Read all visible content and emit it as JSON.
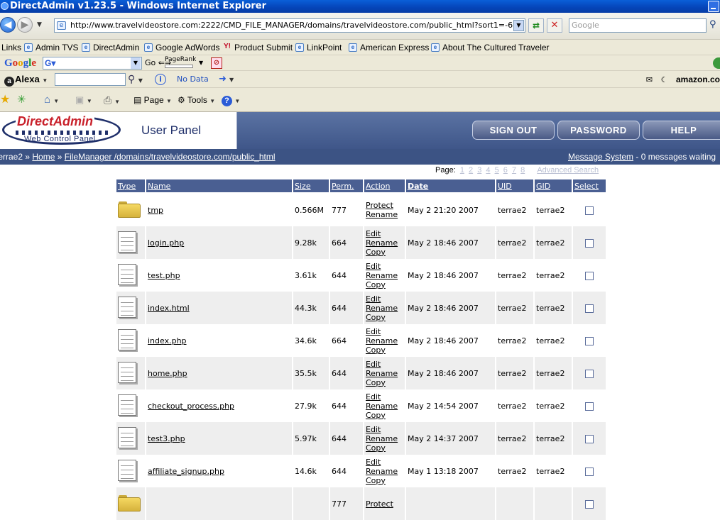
{
  "window": {
    "title": "DirectAdmin v1.23.5 - Windows Internet Explorer"
  },
  "browser": {
    "url": "http://www.travelvideostore.com:2222/CMD_FILE_MANAGER/domains/travelvideostore.com/public_html?sort1=-6",
    "search_placeholder": "Google",
    "links_label": "Links",
    "links": [
      "Admin TVS",
      "DirectAdmin",
      "Google AdWords",
      "Product Submit",
      "LinkPoint",
      "American Express",
      "About The Cultured Traveler"
    ],
    "google_toolbar": {
      "logo": "Google",
      "go_label": "Go",
      "pagerank_label": "PageRank"
    },
    "alexa_toolbar": {
      "logo": "Alexa",
      "status": "No Data",
      "amazon": "amazon.co"
    },
    "command_bar": {
      "page": "Page",
      "tools": "Tools"
    }
  },
  "da_header": {
    "logo_title": "DirectAdmin",
    "logo_subtitle": "Web Control Panel",
    "panel_title": "User Panel",
    "buttons": {
      "signout": "SIGN OUT",
      "password": "PASSWORD",
      "help": "HELP"
    }
  },
  "breadcrumb": {
    "user": "terrae2",
    "home": "Home",
    "path": "FileManager /domains/travelvideostore.com/public_html",
    "message_link": "Message System",
    "message_status": " - 0 messages waiting"
  },
  "pager": {
    "label": "Page:",
    "pages": [
      "1",
      "2",
      "3",
      "4",
      "5",
      "6",
      "7",
      "8"
    ],
    "advanced": "Advanced Search"
  },
  "files": {
    "columns": [
      "Type",
      "Name",
      "Size",
      "Perm.",
      "Action",
      "Date",
      "UID",
      "GID",
      "Select"
    ],
    "rows": [
      {
        "type": "folder",
        "name": "tmp",
        "size": "0.566M",
        "perm": "777",
        "actions": [
          "Protect",
          "Rename"
        ],
        "date": "May 2 21:20 2007",
        "uid": "terrae2",
        "gid": "terrae2"
      },
      {
        "type": "file",
        "name": "login.php",
        "size": "9.28k",
        "perm": "664",
        "actions": [
          "Edit",
          "Rename",
          "Copy"
        ],
        "date": "May 2 18:46 2007",
        "uid": "terrae2",
        "gid": "terrae2"
      },
      {
        "type": "file",
        "name": "test.php",
        "size": "3.61k",
        "perm": "644",
        "actions": [
          "Edit",
          "Rename",
          "Copy"
        ],
        "date": "May 2 18:46 2007",
        "uid": "terrae2",
        "gid": "terrae2"
      },
      {
        "type": "file",
        "name": "index.html",
        "size": "44.3k",
        "perm": "644",
        "actions": [
          "Edit",
          "Rename",
          "Copy"
        ],
        "date": "May 2 18:46 2007",
        "uid": "terrae2",
        "gid": "terrae2"
      },
      {
        "type": "file",
        "name": "index.php",
        "size": "34.6k",
        "perm": "664",
        "actions": [
          "Edit",
          "Rename",
          "Copy"
        ],
        "date": "May 2 18:46 2007",
        "uid": "terrae2",
        "gid": "terrae2"
      },
      {
        "type": "file",
        "name": "home.php",
        "size": "35.5k",
        "perm": "644",
        "actions": [
          "Edit",
          "Rename",
          "Copy"
        ],
        "date": "May 2 18:46 2007",
        "uid": "terrae2",
        "gid": "terrae2"
      },
      {
        "type": "file",
        "name": "checkout_process.php",
        "size": "27.9k",
        "perm": "644",
        "actions": [
          "Edit",
          "Rename",
          "Copy"
        ],
        "date": "May 2 14:54 2007",
        "uid": "terrae2",
        "gid": "terrae2"
      },
      {
        "type": "file",
        "name": "test3.php",
        "size": "5.97k",
        "perm": "644",
        "actions": [
          "Edit",
          "Rename",
          "Copy"
        ],
        "date": "May 2 14:37 2007",
        "uid": "terrae2",
        "gid": "terrae2"
      },
      {
        "type": "file",
        "name": "affiliate_signup.php",
        "size": "14.6k",
        "perm": "644",
        "actions": [
          "Edit",
          "Rename",
          "Copy"
        ],
        "date": "May 1 13:18 2007",
        "uid": "terrae2",
        "gid": "terrae2"
      },
      {
        "type": "folder",
        "name": "",
        "size": "",
        "perm": "777",
        "actions": [
          "Protect"
        ],
        "date": "",
        "uid": "",
        "gid": ""
      }
    ]
  }
}
